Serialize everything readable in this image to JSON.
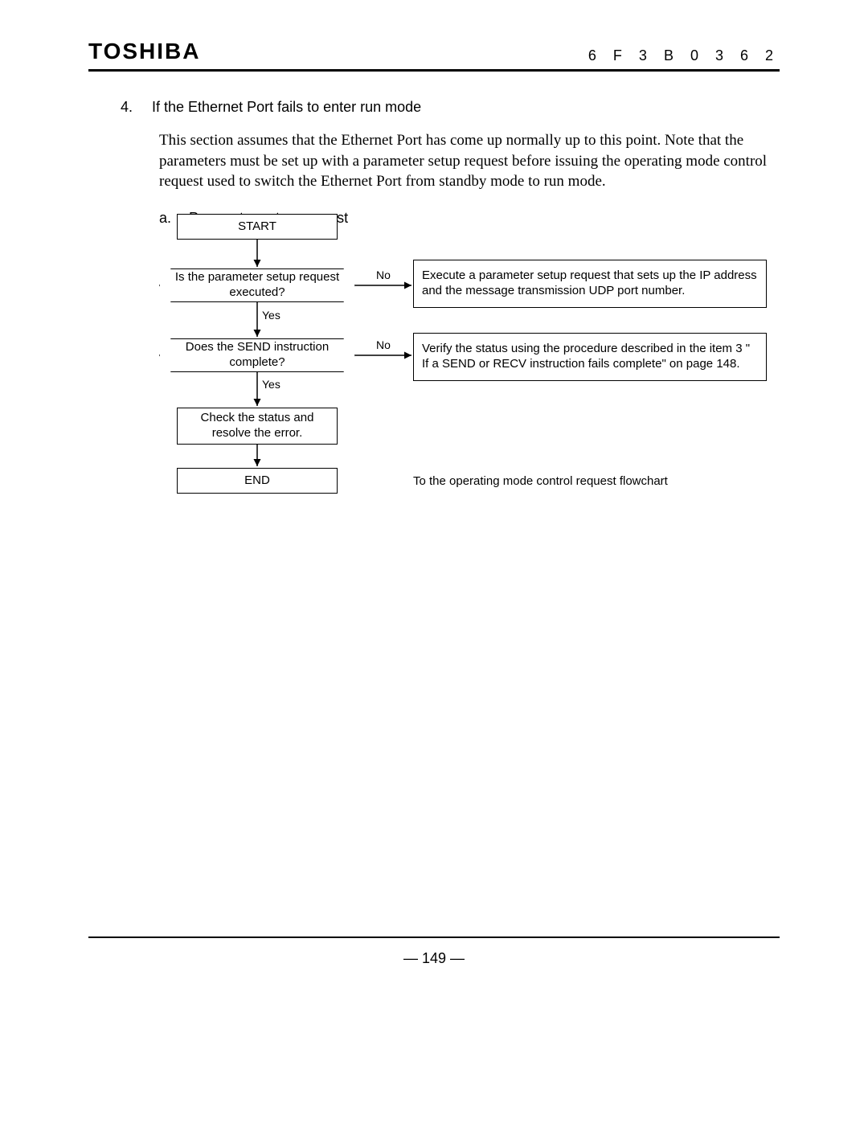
{
  "header": {
    "brand": "TOSHIBA",
    "docnum": "6 F 3 B 0 3 6 2"
  },
  "section": {
    "num": "4.",
    "title": "If the Ethernet Port fails to enter run mode"
  },
  "body": "This section assumes that the Ethernet Port has come up normally up to this point. Note that the parameters must be set up with a parameter setup request before issuing the operating mode control request used to switch the Ethernet Port from standby mode to run mode.",
  "subsection": {
    "num": "a.",
    "title": "Parameter setup request"
  },
  "flow": {
    "start": "START",
    "dec1": "Is the parameter setup request executed?",
    "dec2": "Does the SEND instruction complete?",
    "proc": "Check the status and resolve the error.",
    "end": "END",
    "side1": "Execute a parameter setup request that sets up the IP address and the message transmission UDP port number.",
    "side2": "Verify the status using the procedure described in the item 3 \" If a SEND or RECV instruction fails complete\" on page 148.",
    "note": "To the operating mode control request flowchart",
    "yes": "Yes",
    "no": "No"
  },
  "pagenum": "—  149  —"
}
